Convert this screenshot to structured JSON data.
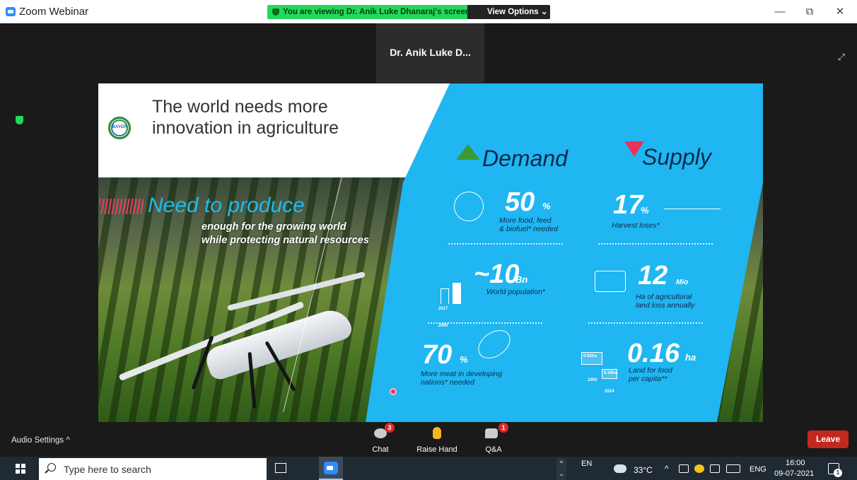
{
  "titlebar": {
    "title": "Zoom Webinar",
    "banner": "You are viewing Dr. Anik Luke Dhanaraj's screen",
    "view_options": "View Options ⌄",
    "min": "—",
    "restore": "⧉",
    "close": "✕"
  },
  "speaker": {
    "name": "Dr. Anik Luke D..."
  },
  "slide": {
    "title_line1": "The world needs more",
    "title_line2": "innovation in agriculture",
    "logo_text": "BAYER",
    "need_title": "Need to produce",
    "need_sub1": "enough for the growing world",
    "need_sub2": "while protecting natural resources",
    "demand": "Demand",
    "supply": "Supply",
    "stats": {
      "food_num": "50",
      "food_unit": "%",
      "food_desc1": "More food, feed",
      "food_desc2": "& biofuel* needed",
      "harvest_num": "17",
      "harvest_unit": "%",
      "harvest_desc": "Harvest loses*",
      "pop_num": "~10",
      "pop_unit": "Bn",
      "pop_desc": "World population*",
      "pop_years1": "2017",
      "pop_years2": "2050",
      "land_num": "12",
      "land_unit": "Mio",
      "land_desc1": "Ha of agricultural",
      "land_desc2": "land loss annually",
      "meat_num": "70",
      "meat_unit": "%",
      "meat_desc1": "More meat in developing",
      "meat_desc2": "nations* needed",
      "capita_num": "0.16",
      "capita_unit": "ha",
      "capita_desc1": "Land for food",
      "capita_desc2": "per capita**",
      "capita_box1": "0.52ha",
      "capita_box2": "0.16ha",
      "capita_year1": "1950",
      "capita_year2": "2014"
    }
  },
  "controls": {
    "audio_settings": "Audio Settings  ^",
    "chat": "Chat",
    "chat_badge": "3",
    "raise_hand": "Raise Hand",
    "qa": "Q&A",
    "qa_badge": "1",
    "leave": "Leave"
  },
  "taskbar": {
    "search_placeholder": "Type here to search",
    "lang_short": "EN",
    "temperature": "33°C",
    "lang": "ENG",
    "time": "16:00",
    "date": "09-07-2021",
    "chevron": "^",
    "chevron_down": "⌄",
    "notif_count": "1"
  },
  "colors": {
    "zoom_blue": "#2d8cff",
    "banner_green": "#23d959",
    "slide_blue": "#1fb6f2",
    "leave_red": "#c2291f"
  }
}
